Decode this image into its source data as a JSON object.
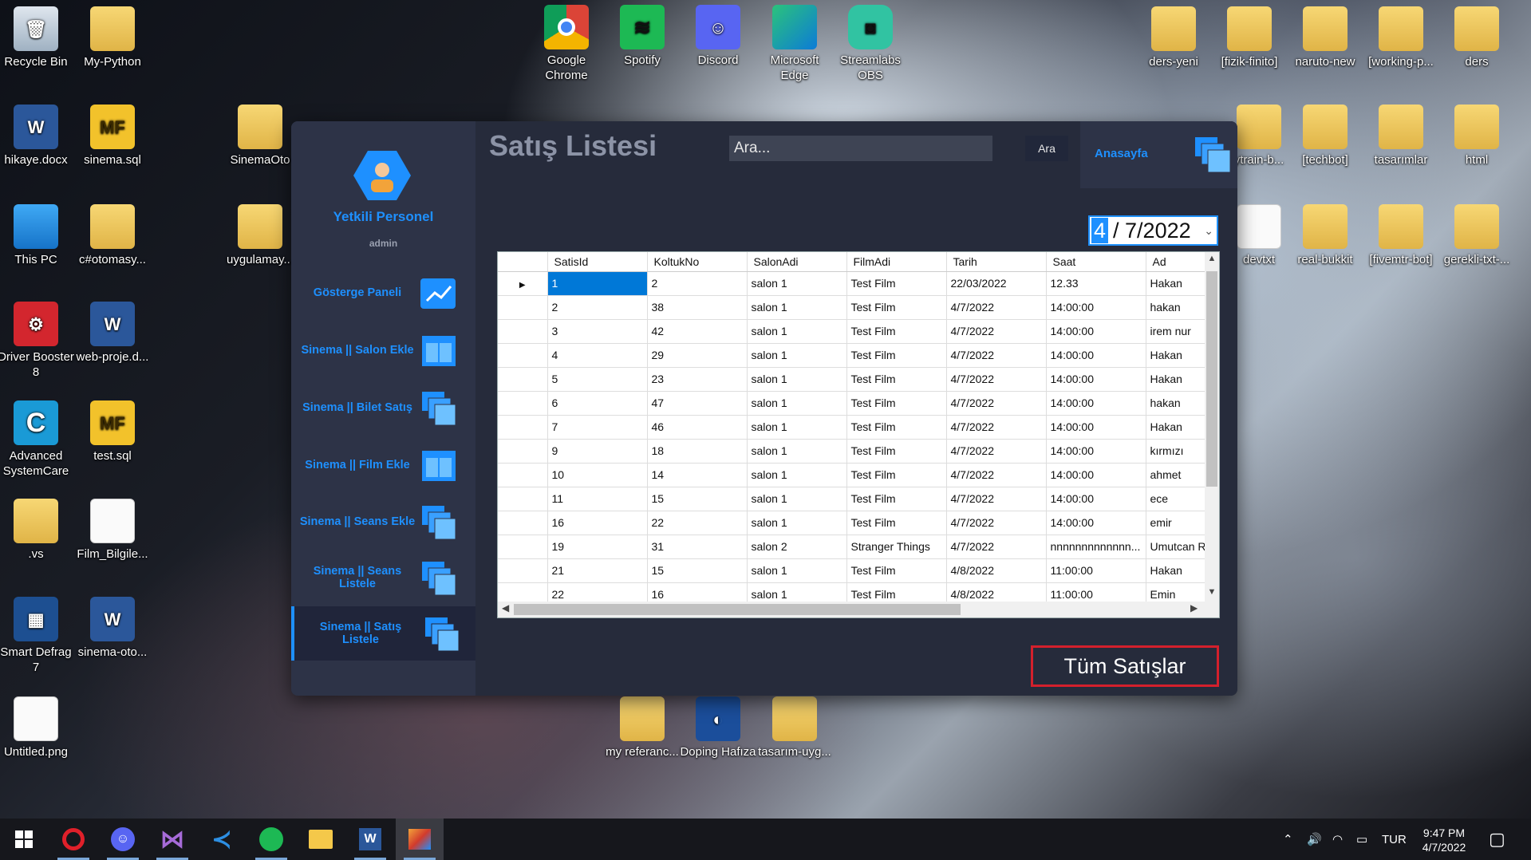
{
  "desktop": {
    "left_icons": [
      {
        "label": "Recycle Bin",
        "icon": "recycle-bin-icon"
      },
      {
        "label": "My-Python",
        "icon": "folder-icon"
      },
      {
        "label": "hikaye.docx",
        "icon": "word-doc-icon"
      },
      {
        "label": "sinema.sql",
        "icon": "mf-sql-icon"
      },
      {
        "label": "SinemaOto",
        "icon": "folder-icon"
      },
      {
        "label": "This PC",
        "icon": "computer-icon"
      },
      {
        "label": "c#otomasy...",
        "icon": "folder-icon"
      },
      {
        "label": "uygulamay...",
        "icon": "folder-icon"
      },
      {
        "label": "Driver Booster 8",
        "icon": "driver-booster-icon"
      },
      {
        "label": "web-proje.d...",
        "icon": "word-doc-icon"
      },
      {
        "label": "Advanced SystemCare",
        "icon": "advanced-systemcare-icon"
      },
      {
        "label": "test.sql",
        "icon": "mf-sql-icon"
      },
      {
        "label": ".vs",
        "icon": "folder-icon"
      },
      {
        "label": "Film_Bilgile...",
        "icon": "file-icon"
      },
      {
        "label": "Smart Defrag 7",
        "icon": "smart-defrag-icon"
      },
      {
        "label": "sinema-oto...",
        "icon": "word-doc-icon"
      },
      {
        "label": "Untitled.png",
        "icon": "image-file-icon"
      }
    ],
    "top_icons": [
      {
        "label": "Google Chrome",
        "icon": "chrome-icon"
      },
      {
        "label": "Spotify",
        "icon": "spotify-icon"
      },
      {
        "label": "Discord",
        "icon": "discord-icon"
      },
      {
        "label": "Microsoft Edge",
        "icon": "edge-icon"
      },
      {
        "label": "Streamlabs OBS",
        "icon": "streamlabs-icon"
      }
    ],
    "right_icons": [
      {
        "label": "ders-yeni",
        "icon": "folder-icon"
      },
      {
        "label": "[fizik-finito]",
        "icon": "folder-icon"
      },
      {
        "label": "naruto-new",
        "icon": "folder-icon"
      },
      {
        "label": "[working-p...",
        "icon": "folder-icon"
      },
      {
        "label": "ders",
        "icon": "folder-icon"
      },
      {
        "label": "ytrain-b...",
        "icon": "folder-icon"
      },
      {
        "label": "[techbot]",
        "icon": "folder-icon"
      },
      {
        "label": "tasarımlar",
        "icon": "folder-icon"
      },
      {
        "label": "html",
        "icon": "folder-icon"
      },
      {
        "label": "devtxt",
        "icon": "file-icon"
      },
      {
        "label": "real-bukkit",
        "icon": "folder-icon"
      },
      {
        "label": "[fivemtr-bot]",
        "icon": "folder-icon"
      },
      {
        "label": "gerekli-txt-...",
        "icon": "folder-icon"
      }
    ],
    "bottom_icons": [
      {
        "label": "my referanc...",
        "icon": "folder-icon"
      },
      {
        "label": "Doping Hafıza",
        "icon": "doping-icon"
      },
      {
        "label": "tasarım-uyg...",
        "icon": "folder-icon"
      }
    ]
  },
  "app": {
    "title": "Satış Listesi",
    "user": {
      "title": "Yetkili Personel",
      "role": "admin"
    },
    "nav": [
      {
        "label": "Gösterge Paneli",
        "icon": "chart-icon"
      },
      {
        "label": "Sinema || Salon Ekle",
        "icon": "window-icon"
      },
      {
        "label": "Sinema || Bilet Satış",
        "icon": "stack-icon"
      },
      {
        "label": "Sinema || Film Ekle",
        "icon": "window-icon"
      },
      {
        "label": "Sinema || Seans Ekle",
        "icon": "stack-icon"
      },
      {
        "label": "Sinema || Seans Listele",
        "icon": "stack-icon"
      },
      {
        "label": "Sinema || Satış Listele",
        "icon": "stack-icon"
      }
    ],
    "search": {
      "placeholder": "Ara...",
      "button": "Ara"
    },
    "home": {
      "label": "Anasayfa"
    },
    "date": {
      "day": "4",
      "rest": "/  7/2022"
    },
    "all_sales_button": "Tüm Satışlar",
    "grid": {
      "columns": [
        "SatisId",
        "KoltukNo",
        "SalonAdi",
        "FilmAdi",
        "Tarih",
        "Saat",
        "Ad"
      ],
      "rows": [
        [
          "1",
          "2",
          "salon 1",
          "Test Film",
          "22/03/2022",
          "12.33",
          "Hakan"
        ],
        [
          "2",
          "38",
          "salon 1",
          "Test Film",
          "4/7/2022",
          "14:00:00",
          "hakan"
        ],
        [
          "3",
          "42",
          "salon 1",
          "Test Film",
          "4/7/2022",
          "14:00:00",
          "irem nur"
        ],
        [
          "4",
          "29",
          "salon 1",
          "Test Film",
          "4/7/2022",
          "14:00:00",
          "Hakan"
        ],
        [
          "5",
          "23",
          "salon 1",
          "Test Film",
          "4/7/2022",
          "14:00:00",
          "Hakan"
        ],
        [
          "6",
          "47",
          "salon 1",
          "Test Film",
          "4/7/2022",
          "14:00:00",
          "hakan"
        ],
        [
          "7",
          "46",
          "salon 1",
          "Test Film",
          "4/7/2022",
          "14:00:00",
          "Hakan"
        ],
        [
          "9",
          "18",
          "salon 1",
          "Test Film",
          "4/7/2022",
          "14:00:00",
          "kırmızı"
        ],
        [
          "10",
          "14",
          "salon 1",
          "Test Film",
          "4/7/2022",
          "14:00:00",
          "ahmet"
        ],
        [
          "11",
          "15",
          "salon 1",
          "Test Film",
          "4/7/2022",
          "14:00:00",
          "ece"
        ],
        [
          "16",
          "22",
          "salon 1",
          "Test Film",
          "4/7/2022",
          "14:00:00",
          "emir"
        ],
        [
          "19",
          "31",
          "salon 2",
          "Stranger Things",
          "4/7/2022",
          "nnnnnnnnnnnnn...",
          "Umutcan R"
        ],
        [
          "21",
          "15",
          "salon 1",
          "Test Film",
          "4/8/2022",
          "11:00:00",
          "Hakan"
        ],
        [
          "22",
          "16",
          "salon 1",
          "Test Film",
          "4/8/2022",
          "11:00:00",
          "Emin"
        ]
      ]
    }
  },
  "taskbar": {
    "apps": [
      "windows-start-icon",
      "opera-icon",
      "discord-icon",
      "visual-studio-icon",
      "vscode-icon",
      "spotify-icon",
      "file-explorer-icon",
      "word-icon",
      "app-window-icon"
    ],
    "language": "TUR",
    "time": "9:47 PM",
    "date": "4/7/2022"
  }
}
